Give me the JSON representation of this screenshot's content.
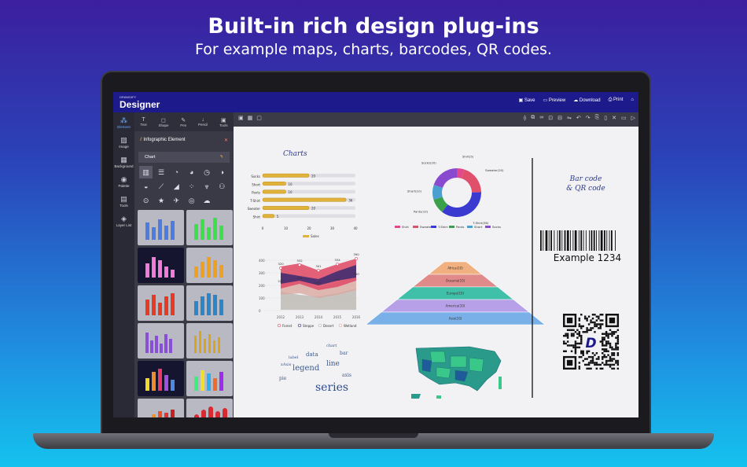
{
  "headline": {
    "title": "Built-in rich design plug-ins",
    "subtitle": "For example maps, charts, barcodes, QR codes."
  },
  "app": {
    "brand_small": "DRAWDIFY",
    "brand": "Designer",
    "actions": [
      "Save",
      "Preview",
      "Download",
      "Print"
    ]
  },
  "rail": [
    "Element",
    "Image",
    "Background",
    "Palette",
    "Tools",
    "Layer List"
  ],
  "tools": [
    "Text",
    "Shape",
    "Pen",
    "Pencil",
    "Tools"
  ],
  "panel": {
    "title": "Infographic Element",
    "section": "Chart"
  },
  "canvas": {
    "charts_title": "Charts",
    "barcode_title": "Bar code\n& QR code",
    "barcode_text": "Example 1234"
  },
  "colors": {
    "bg_top": "#3b1f9e",
    "bg_bottom": "#14c2ee",
    "titlebar": "#1d1a8c"
  },
  "chart_data": [
    {
      "type": "bar",
      "orientation": "horizontal",
      "categories": [
        "Socks",
        "Short",
        "Pants",
        "T-Shirt",
        "Sweater",
        "Shirt"
      ],
      "values": [
        20,
        10,
        10,
        36,
        20,
        5
      ],
      "series": [
        {
          "name": "Sales",
          "values": [
            20,
            10,
            10,
            36,
            20,
            5
          ]
        }
      ],
      "xlim": [
        0,
        40
      ],
      "xticks": [
        "0",
        "10",
        "20",
        "30",
        "40"
      ]
    },
    {
      "type": "pie",
      "labels": [
        "Shirt(5)",
        "Sweater(20)",
        "T-Shirt(36)",
        "Pants(10)",
        "Short(10)",
        "Socks(20)"
      ],
      "values": [
        5,
        20,
        36,
        10,
        10,
        20
      ],
      "legend": [
        "Shirt",
        "Sweater",
        "T-Shirt",
        "Pants",
        "Short",
        "Socks"
      ]
    },
    {
      "type": "area",
      "x": [
        "2012",
        "2013",
        "2014",
        "2015",
        "2016"
      ],
      "yticks": [
        "0",
        "100",
        "200",
        "300",
        "400"
      ],
      "value_labels": [
        "320",
        "332",
        "301",
        "334",
        "390",
        "220",
        "182",
        "191",
        "234",
        "290"
      ],
      "legend": [
        "Forest",
        "Steppe",
        "Desert",
        "Wetland"
      ]
    },
    {
      "type": "funnel",
      "labels": [
        "Africa(10)",
        "Oceania(10)",
        "Europe(10)",
        "America(10)",
        "Asia(10)"
      ]
    }
  ],
  "wordcloud": [
    "series",
    "legend",
    "line",
    "data",
    "bar",
    "pie",
    "axis",
    "label",
    "chart",
    "xAxis"
  ]
}
